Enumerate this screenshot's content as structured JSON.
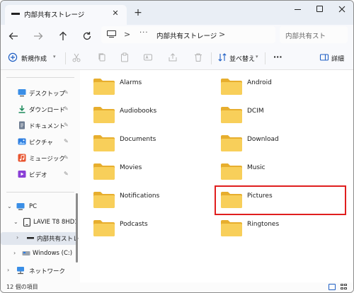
{
  "window": {
    "tab_title": "内部共有ストレージ",
    "tab_close": "✕",
    "new_tab": "+"
  },
  "address": {
    "ellipsis": "···",
    "separator": ">",
    "crumb": "内部共有ストレージ",
    "search_placeholder": "内部共有スト"
  },
  "commands": {
    "new_label": "新規作成",
    "sort_label": "並べ替え",
    "more": "···",
    "details_label": "詳細"
  },
  "nav": {
    "quick_access": [
      {
        "label": "デスクトップ",
        "icon": "desktop-icon"
      },
      {
        "label": "ダウンロード",
        "icon": "download-icon"
      },
      {
        "label": "ドキュメント",
        "icon": "documents-icon"
      },
      {
        "label": "ピクチャ",
        "icon": "pictures-icon"
      },
      {
        "label": "ミュージック",
        "icon": "music-icon"
      },
      {
        "label": "ビデオ",
        "icon": "videos-icon"
      }
    ],
    "tree": [
      {
        "label": "PC"
      },
      {
        "label": "LAVIE T8 8HD1"
      },
      {
        "label": "内部共有ストレ"
      },
      {
        "label": "Windows (C:)"
      },
      {
        "label": "ネットワーク"
      }
    ],
    "pin_glyph": "📌"
  },
  "folders": [
    {
      "name": "Alarms"
    },
    {
      "name": "Android"
    },
    {
      "name": "Audiobooks"
    },
    {
      "name": "DCIM"
    },
    {
      "name": "Documents"
    },
    {
      "name": "Download"
    },
    {
      "name": "Movies"
    },
    {
      "name": "Music"
    },
    {
      "name": "Notifications"
    },
    {
      "name": "Pictures"
    },
    {
      "name": "Podcasts"
    },
    {
      "name": "Ringtones"
    }
  ],
  "status": {
    "item_count": "12 個の項目"
  },
  "colors": {
    "folder_body": "#f8cf5a",
    "folder_back": "#e7ae2e",
    "highlight": "#e01e1e",
    "accent": "#1f5fc4"
  }
}
